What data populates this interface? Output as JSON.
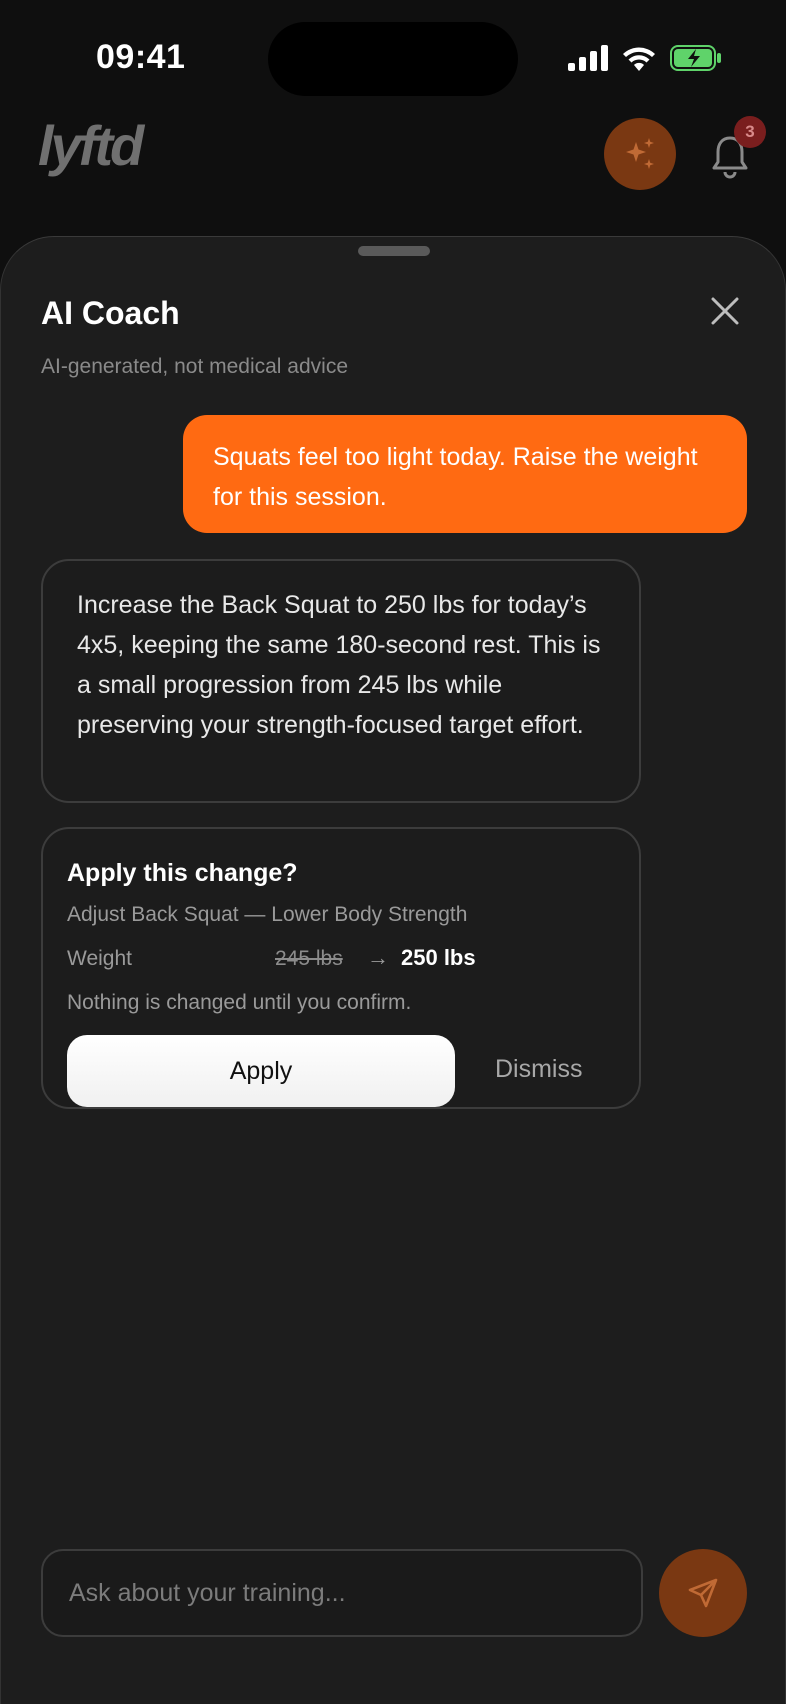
{
  "status_bar": {
    "time": "09:41"
  },
  "app": {
    "logo_text": "lyftd",
    "notification_count": "3",
    "accent_color": "#ff6a12"
  },
  "sheet": {
    "title": "AI Coach",
    "disclaimer": "AI-generated, not medical advice",
    "close_icon": "close-icon"
  },
  "messages": {
    "user": "Squats feel too light today. Raise the weight for this session.",
    "assistant": "Increase the Back Squat to 250 lbs for today’s 4x5, keeping the same 180-second rest. This is a small progression from 245 lbs while preserving your strength-focused target effort."
  },
  "change_card": {
    "title": "Apply this change?",
    "subtitle": "Adjust Back Squat — Lower Body Strength",
    "field_label": "Weight",
    "old_value": "245 lbs",
    "arrow": "→",
    "new_value": "250 lbs",
    "note": "Nothing is changed until you confirm.",
    "apply_label": "Apply",
    "dismiss_label": "Dismiss"
  },
  "composer": {
    "placeholder": "Ask about your training...",
    "send_icon": "send-icon"
  }
}
